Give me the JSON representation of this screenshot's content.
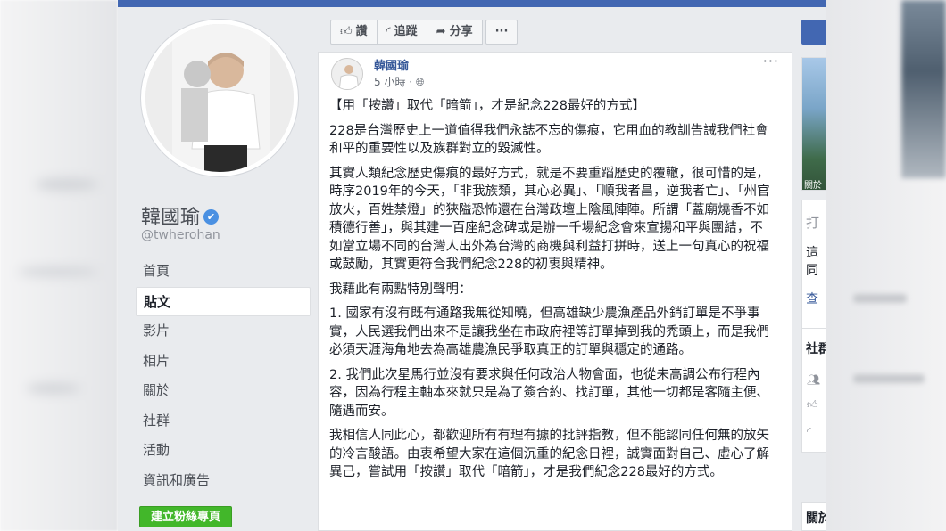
{
  "profile": {
    "name": "韓國瑜",
    "verified_mark": "✔",
    "handle": "@twherohan"
  },
  "nav": {
    "items": [
      {
        "label": "首頁"
      },
      {
        "label": "貼文",
        "active": true
      },
      {
        "label": "影片"
      },
      {
        "label": "相片"
      },
      {
        "label": "關於"
      },
      {
        "label": "社群"
      },
      {
        "label": "活動"
      },
      {
        "label": "資訊和廣告"
      }
    ],
    "create_page_label": "建立粉絲專頁"
  },
  "actions": {
    "like_icon": "thumbs-up-icon",
    "like_label": "讚",
    "follow_icon": "rss-icon",
    "follow_label": "追蹤",
    "share_icon": "share-arrow-icon",
    "share_label": "分享",
    "more_label": "···"
  },
  "post": {
    "author": "韓國瑜",
    "time": "5 小時 · ",
    "more": "···",
    "paragraphs": [
      "【用「按讚」取代「暗箭」，才是紀念228最好的方式】",
      "228是台灣歷史上一道值得我們永誌不忘的傷痕，它用血的教訓告誡我們社會和平的重要性以及族群對立的毀滅性。",
      "其實人類紀念歷史傷痕的最好方式，就是不要重蹈歷史的覆轍，很可惜的是，時序2019年的今天，「非我族類，其心必異」、「順我者昌，逆我者亡」、「州官放火，百姓禁燈」的狹隘恐怖還在台灣政壇上陰風陣陣。所謂「蓋廟燒香不如積德行善」，與其建一百座紀念碑或是辦一千場紀念會來宣揚和平與團結，不如當立場不同的台灣人出外為台灣的商機與利益打拼時，送上一句真心的祝福或鼓勵，其實更符合我們紀念228的初衷與精神。",
      "我藉此有兩點特別聲明：",
      "1. 國家有沒有既有通路我無從知曉，但高雄缺少農漁產品外銷訂單是不爭事實，人民選我們出來不是讓我坐在市政府裡等訂單掉到我的禿頭上，而是我們必須天涯海角地去為高雄農漁民爭取真正的訂單與穩定的通路。",
      "2. 我們此次星馬行並沒有要求與任何政治人物會面，也從未高調公布行程內容，因為行程主軸本來就只是為了簽合約、找訂單，其他一切都是客隨主便、隨遇而安。",
      "我相信人同此心，都歡迎所有有理有據的批評指教，但不能認同任何無的放矢的冷言酸語。由衷希望大家在這個沉重的紀念日裡，誠實面對自己、虛心了解異己，嘗試用「按讚」取代「暗箭」，才是我們紀念228最好的方式。"
    ]
  },
  "right": {
    "card_label": "關於",
    "texts": [
      "打",
      "這",
      "同",
      "查",
      "社群",
      "關於"
    ]
  }
}
